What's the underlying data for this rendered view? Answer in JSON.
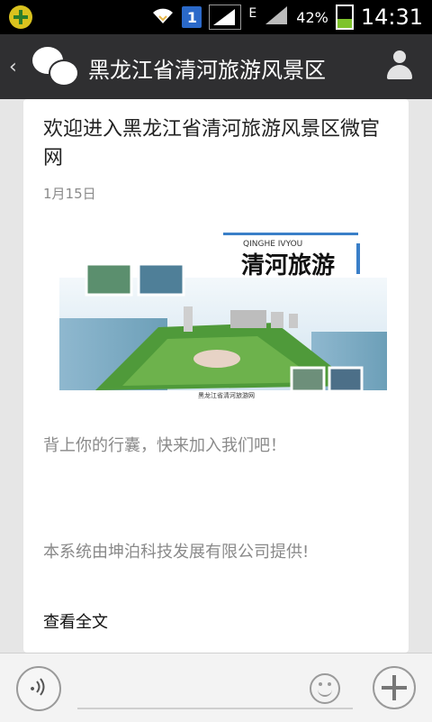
{
  "statusbar": {
    "network_type": "E",
    "battery_percent": "42%",
    "time": "14:31",
    "sim_label": "1"
  },
  "titlebar": {
    "back_label": "‹",
    "title": "黑龙江省清河旅游风景区"
  },
  "article": {
    "title": "欢迎进入黑龙江省清河旅游风景区微官网",
    "date": "1月15日",
    "image_banner": {
      "subtitle": "QINGHE IVYOU",
      "headline": "清河旅游",
      "caption": "黑龙江省清河旅游网"
    },
    "description": "背上你的行囊，快来加入我们吧！",
    "provider": "本系统由坤泊科技发展有限公司提供!",
    "read_more": "查看全文"
  },
  "colors": {
    "titlebar_bg": "#2f2f31",
    "page_bg": "#e6e6e6",
    "card_bg": "#ffffff",
    "muted_text": "#8a8a8a"
  }
}
